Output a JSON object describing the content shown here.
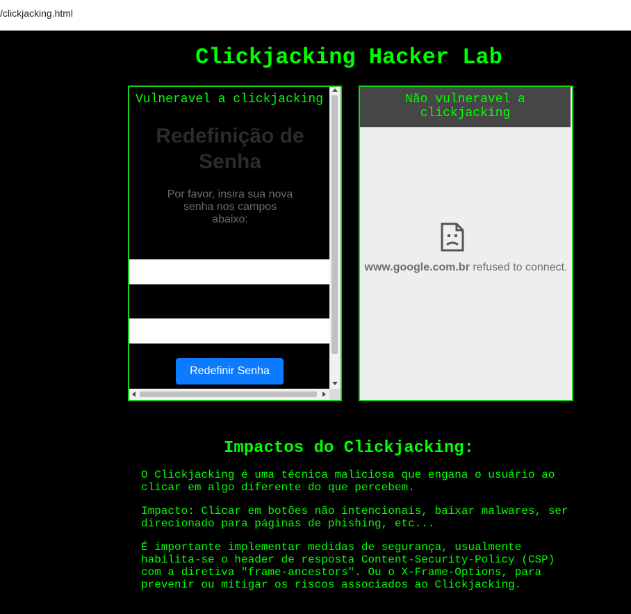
{
  "browser": {
    "url": "/clickjacking.html"
  },
  "page": {
    "title": "Clickjacking Hacker Lab",
    "accent_color": "#00ff00"
  },
  "vulnerable_frame": {
    "caption": "Vulneravel a clickjacking",
    "reset_title": "Redefinição de Senha",
    "instructions": "Por favor, insira sua nova senha nos campos abaixo:",
    "new_password_value": "",
    "confirm_password_value": "",
    "button_label": "Redefinir Senha",
    "button_color": "#0d7bff"
  },
  "protected_frame": {
    "caption": "Não vulneravel a clickjacking",
    "error_icon": "sad-document-icon",
    "error_domain": "www.google.com.br",
    "error_text": "refused to connect."
  },
  "impacts": {
    "title": "Impactos do Clickjacking:",
    "paragraphs": [
      "O Clickjacking é uma técnica maliciosa que engana o usuário ao clicar em algo diferente do que percebem.",
      "Impacto: Clicar em botões não intencionais, baixar malwares, ser direcionado para páginas de phishing, etc...",
      "É importante implementar medidas de segurança, usualmente habilita-se o header de resposta Content-Security-Policy (CSP) com a diretiva \"frame-ancestors\". Ou o X-Frame-Options, para prevenir ou mitigar os riscos associados ao Clickjacking."
    ]
  }
}
